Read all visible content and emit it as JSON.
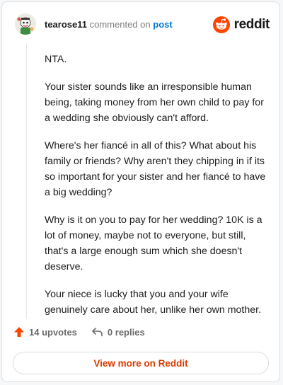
{
  "header": {
    "username": "tearose11",
    "commented_on": "commented on",
    "post_link": "post"
  },
  "brand": {
    "wordmark": "reddit",
    "logo_icon": "reddit-snoo-icon",
    "accent_color": "#ff4500"
  },
  "comment": {
    "paragraphs": [
      "NTA.",
      "Your sister sounds like an irresponsible human being, taking money from her own child to pay for a wedding she obviously can't afford.",
      "Where's her fiancé in all of this? What about his family or friends? Why aren't they chipping in if its so important for your sister and her fiancé to have a big wedding?",
      "Why is it on you to pay for her wedding? 10K is a lot of money, maybe not to everyone, but still, that's a large enough sum which she doesn't deserve.",
      "Your niece is lucky that you and your wife genuinely care about her, unlike her own mother."
    ]
  },
  "actions": {
    "upvotes": "14 upvotes",
    "replies": "0 replies",
    "upvote_icon": "upvote-arrow-icon",
    "reply_icon": "reply-arrow-icon"
  },
  "footer": {
    "view_more": "View more on Reddit",
    "link_color": "#d93a00"
  }
}
